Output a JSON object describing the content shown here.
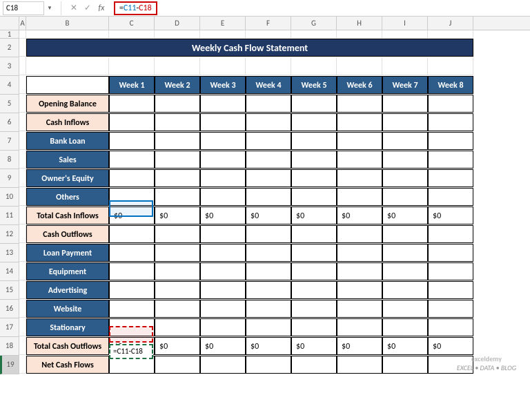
{
  "nameBox": "C18",
  "formula": {
    "eq": "=",
    "ref1": "C11",
    "op": "-",
    "ref2": "C18"
  },
  "title": "Weekly Cash Flow Statement",
  "weeks": [
    "Week 1",
    "Week 2",
    "Week 3",
    "Week 4",
    "Week 5",
    "Week 6",
    "Week 7",
    "Week 8"
  ],
  "rows": {
    "openingBalance": "Opening Balance",
    "cashInflows": "Cash Inflows",
    "bankLoan": "Bank Loan",
    "sales": "Sales",
    "ownersEquity": "Owner's Equity",
    "others": "Others",
    "totalInflows": "Total Cash Inflows",
    "cashOutflows": "Cash Outflows",
    "loanPayment": "Loan Payment",
    "equipment": "Equipment",
    "advertising": "Advertising",
    "website": "Website",
    "stationary": "Stationary",
    "totalOutflows": "Total Cash Outflows",
    "netCashFlows": "Net Cash Flows"
  },
  "zero": "$0",
  "editingFormula": "=C11-C18",
  "cols": [
    "A",
    "B",
    "C",
    "D",
    "E",
    "F",
    "G",
    "H",
    "I",
    "J"
  ],
  "rowNums": [
    1,
    2,
    3,
    4,
    5,
    6,
    7,
    8,
    9,
    10,
    11,
    12,
    13,
    14,
    15,
    16,
    17,
    18,
    19
  ],
  "watermark": {
    "brand": "exceldemy",
    "tag": "EXCEL • DATA • BLOG"
  }
}
